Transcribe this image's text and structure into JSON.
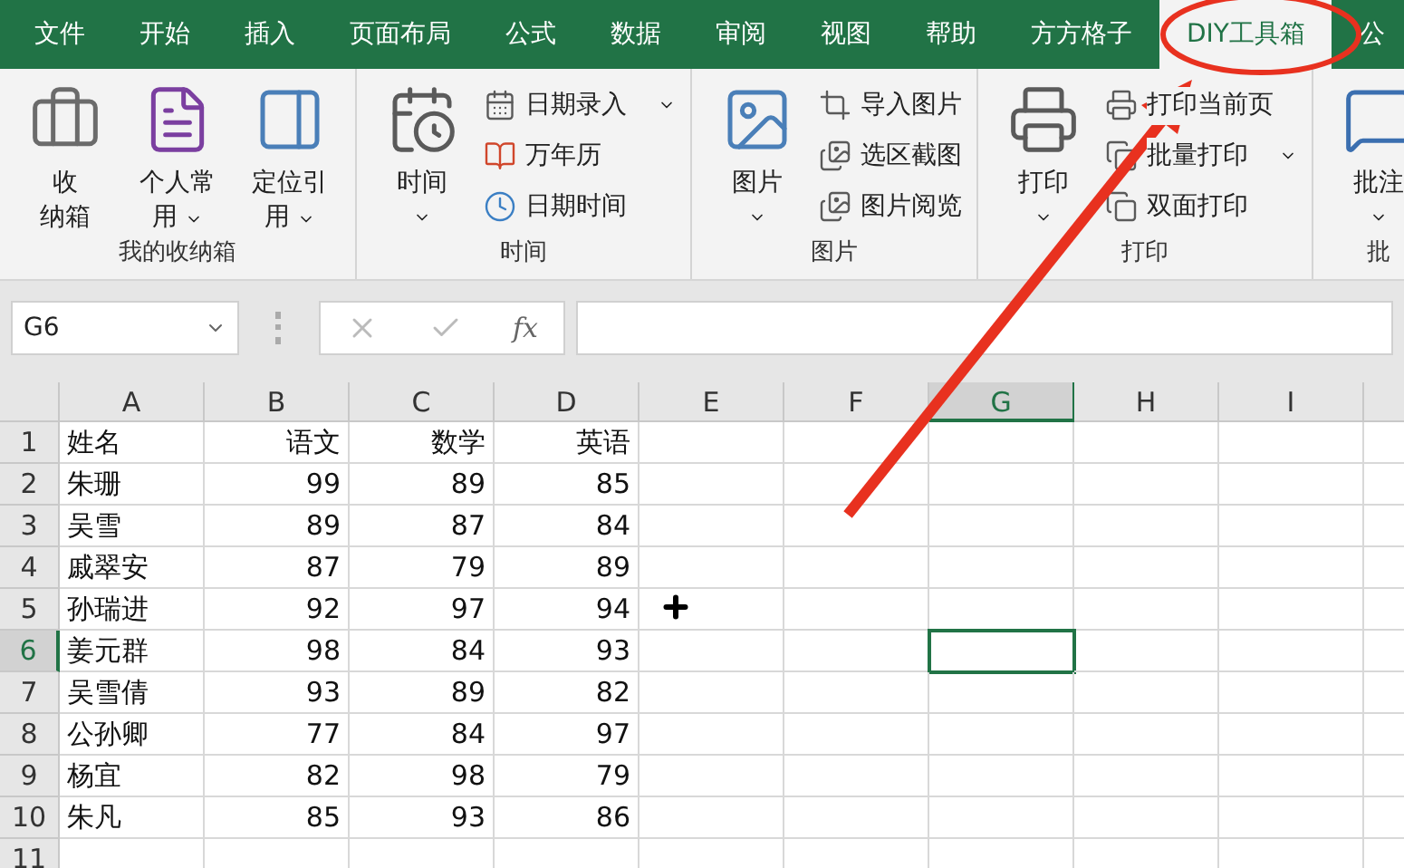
{
  "tabs": [
    {
      "label": "文件",
      "selected": false
    },
    {
      "label": "开始",
      "selected": false
    },
    {
      "label": "插入",
      "selected": false
    },
    {
      "label": "页面布局",
      "selected": false
    },
    {
      "label": "公式",
      "selected": false
    },
    {
      "label": "数据",
      "selected": false
    },
    {
      "label": "审阅",
      "selected": false
    },
    {
      "label": "视图",
      "selected": false
    },
    {
      "label": "帮助",
      "selected": false
    },
    {
      "label": "方方格子",
      "selected": false
    },
    {
      "label": "DIY工具箱",
      "selected": true
    },
    {
      "label": "公",
      "selected": false
    }
  ],
  "ribbon": [
    {
      "label": "我的收纳箱",
      "items": [
        {
          "kind": "large",
          "lines": [
            "收",
            "纳箱"
          ],
          "dropdown": false
        },
        {
          "kind": "large",
          "lines": [
            "个人常",
            "用"
          ],
          "dropdown": true
        },
        {
          "kind": "large",
          "lines": [
            "定位引",
            "用"
          ],
          "dropdown": true
        }
      ]
    },
    {
      "label": "时间",
      "items": [
        {
          "kind": "large",
          "lines": [
            "时间"
          ],
          "dropdown": true
        },
        {
          "kind": "small",
          "label": "日期录入",
          "dropdown": true
        },
        {
          "kind": "small",
          "label": "万年历",
          "dropdown": false
        },
        {
          "kind": "small",
          "label": "日期时间",
          "dropdown": false
        }
      ]
    },
    {
      "label": "图片",
      "items": [
        {
          "kind": "large",
          "lines": [
            "图片"
          ],
          "dropdown": true
        },
        {
          "kind": "small",
          "label": "导入图片",
          "dropdown": false
        },
        {
          "kind": "small",
          "label": "选区截图",
          "dropdown": false
        },
        {
          "kind": "small",
          "label": "图片阅览",
          "dropdown": false
        }
      ]
    },
    {
      "label": "打印",
      "items": [
        {
          "kind": "large",
          "lines": [
            "打印"
          ],
          "dropdown": true
        },
        {
          "kind": "small",
          "label": "打印当前页",
          "dropdown": false
        },
        {
          "kind": "small",
          "label": "批量打印",
          "dropdown": true
        },
        {
          "kind": "small",
          "label": "双面打印",
          "dropdown": false
        }
      ]
    },
    {
      "label": "批",
      "items": [
        {
          "kind": "large",
          "lines": [
            "批注"
          ],
          "dropdown": true
        }
      ]
    }
  ],
  "formula_bar": {
    "name_box": "G6",
    "fx": "fx"
  },
  "sheet": {
    "columns": [
      {
        "label": "A",
        "selected": false
      },
      {
        "label": "B",
        "selected": false
      },
      {
        "label": "C",
        "selected": false
      },
      {
        "label": "D",
        "selected": false
      },
      {
        "label": "E",
        "selected": false
      },
      {
        "label": "F",
        "selected": false
      },
      {
        "label": "G",
        "selected": true
      },
      {
        "label": "H",
        "selected": false
      },
      {
        "label": "I",
        "selected": false
      }
    ],
    "rows": [
      {
        "number": "1",
        "selected": false,
        "cells": [
          "姓名",
          "语文",
          "数学",
          "英语"
        ]
      },
      {
        "number": "2",
        "selected": false,
        "cells": [
          "朱珊",
          "99",
          "89",
          "85"
        ]
      },
      {
        "number": "3",
        "selected": false,
        "cells": [
          "吴雪",
          "89",
          "87",
          "84"
        ]
      },
      {
        "number": "4",
        "selected": false,
        "cells": [
          "戚翠安",
          "87",
          "79",
          "89"
        ]
      },
      {
        "number": "5",
        "selected": false,
        "cells": [
          "孙瑞进",
          "92",
          "97",
          "94"
        ]
      },
      {
        "number": "6",
        "selected": true,
        "cells": [
          "姜元群",
          "98",
          "84",
          "93"
        ]
      },
      {
        "number": "7",
        "selected": false,
        "cells": [
          "吴雪倩",
          "93",
          "89",
          "82"
        ]
      },
      {
        "number": "8",
        "selected": false,
        "cells": [
          "公孙卿",
          "77",
          "84",
          "97"
        ]
      },
      {
        "number": "9",
        "selected": false,
        "cells": [
          "杨宜",
          "82",
          "98",
          "79"
        ]
      },
      {
        "number": "10",
        "selected": false,
        "cells": [
          "朱凡",
          "85",
          "93",
          "86"
        ]
      },
      {
        "number": "11",
        "selected": false,
        "cells": []
      }
    ]
  }
}
